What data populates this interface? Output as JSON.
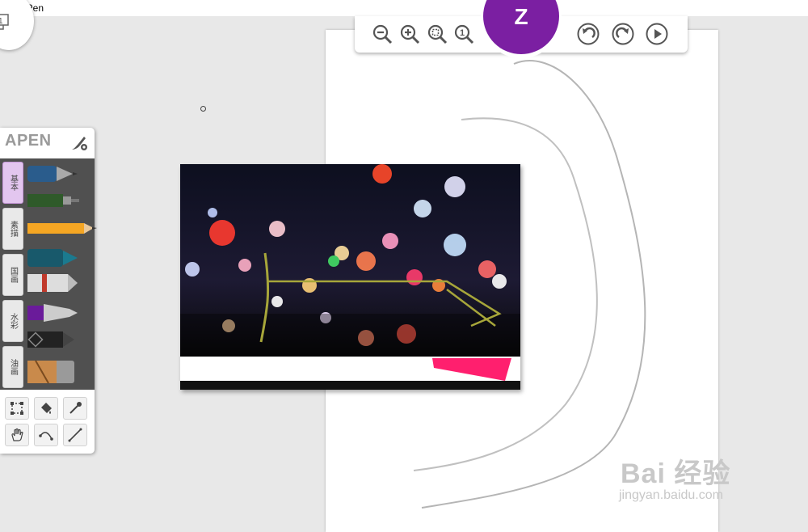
{
  "window": {
    "title": "AirPen"
  },
  "layers": {
    "count": "1"
  },
  "toolbar": {
    "buttons": [
      "zoom-out",
      "zoom-in",
      "zoom-fit",
      "zoom-actual",
      "undo",
      "redo",
      "play"
    ],
    "logo_letter": "Z",
    "accent": "#7b1fa2"
  },
  "panel": {
    "brand": "APEN",
    "categories": [
      {
        "label": "基本",
        "active": true
      },
      {
        "label": "素描",
        "active": false
      },
      {
        "label": "国画",
        "active": false
      },
      {
        "label": "水彩",
        "active": false
      },
      {
        "label": "油画",
        "active": false
      }
    ],
    "tools": [
      "select-tool",
      "fill-bucket-tool",
      "eyedropper-tool",
      "hand-tool",
      "curve-tool",
      "line-tool"
    ]
  },
  "watermark": {
    "main": "Bai 经验",
    "sub": "jingyan.baidu.com"
  }
}
